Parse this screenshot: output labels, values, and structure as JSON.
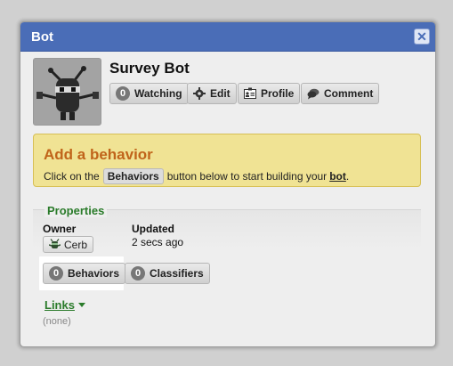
{
  "dialog": {
    "title": "Bot",
    "close_label": "✕"
  },
  "bot": {
    "name": "Survey Bot"
  },
  "actions": {
    "watch_count": "0",
    "watch_label": "Watching",
    "edit_label": "Edit",
    "profile_label": "Profile",
    "comment_label": "Comment"
  },
  "callout": {
    "heading": "Add a behavior",
    "text_before": "Click on the",
    "button_word": "Behaviors",
    "text_middle": "button below to start building your",
    "bold_word": "bot",
    "text_after": "."
  },
  "properties": {
    "title": "Properties",
    "owner_label": "Owner",
    "owner_value": "Cerb",
    "updated_label": "Updated",
    "updated_value": "2 secs ago"
  },
  "tabs": {
    "behaviors_count": "0",
    "behaviors_label": "Behaviors",
    "classifiers_count": "0",
    "classifiers_label": "Classifiers"
  },
  "links": {
    "label": "Links",
    "empty": "(none)"
  },
  "colors": {
    "titlebar": "#4a6db7",
    "accent_green": "#2a7b2a",
    "callout_bg": "#f0e394",
    "callout_heading": "#c0641a"
  }
}
